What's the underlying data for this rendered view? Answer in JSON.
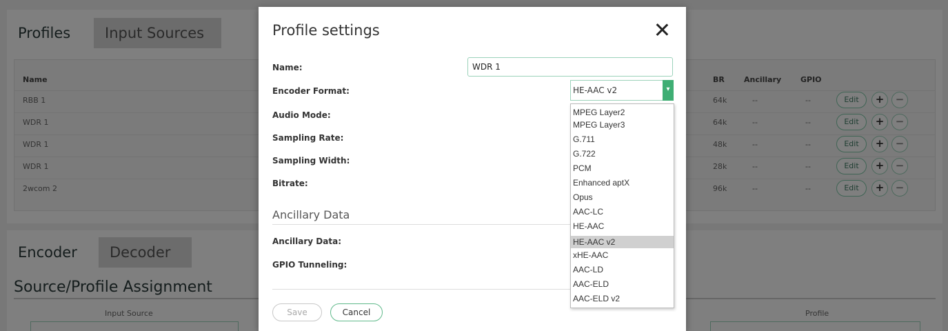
{
  "background": {
    "top_tabs": [
      "Profiles",
      "Input Sources"
    ],
    "table": {
      "headers": {
        "name": "Name",
        "br": "BR",
        "ancillary": "Ancillary",
        "gpio": "GPIO"
      },
      "rows": [
        {
          "name": "RBB 1",
          "br": "64k",
          "ancillary": "--",
          "gpio": "--",
          "edit": "Edit"
        },
        {
          "name": "WDR 1",
          "br": "64k",
          "ancillary": "--",
          "gpio": "--",
          "edit": "Edit"
        },
        {
          "name": "WDR 1",
          "br": "48k",
          "ancillary": "--",
          "gpio": "--",
          "edit": "Edit"
        },
        {
          "name": "WDR 1",
          "br": "28k",
          "ancillary": "--",
          "gpio": "--",
          "edit": "Edit"
        },
        {
          "name": "2wcom 2",
          "br": "96k",
          "ancillary": "--",
          "gpio": "--",
          "edit": "Edit"
        }
      ]
    },
    "bottom_tabs": [
      "Encoder",
      "Decoder"
    ],
    "section_title": "Source/Profile Assignment",
    "columns": {
      "input_source": "Input Source",
      "profile": "Profile"
    }
  },
  "modal": {
    "title": "Profile settings",
    "fields": {
      "name_label": "Name:",
      "name_value": "WDR 1",
      "encoder_format_label": "Encoder Format:",
      "encoder_format_value": "HE-AAC v2",
      "audio_mode_label": "Audio Mode:",
      "sampling_rate_label": "Sampling Rate:",
      "sampling_width_label": "Sampling Width:",
      "bitrate_label": "Bitrate:"
    },
    "ancillary_section_title": "Ancillary Data",
    "ancillary_fields": {
      "ancillary_label": "Ancillary Data:",
      "gpio_label": "GPIO Tunneling:"
    },
    "buttons": {
      "save": "Save",
      "cancel": "Cancel"
    },
    "dropdown": {
      "options": [
        "MPEG Layer2",
        "MPEG Layer3",
        "G.711",
        "G.722",
        "PCM",
        "Enhanced aptX",
        "Opus",
        "AAC-LC",
        "HE-AAC",
        "HE-AAC v2",
        "xHE-AAC",
        "AAC-LD",
        "AAC-ELD",
        "AAC-ELD v2"
      ],
      "selected": "HE-AAC v2"
    }
  },
  "colors": {
    "accent": "#3fae74",
    "overlay": "rgba(0,0,0,0.5)"
  }
}
